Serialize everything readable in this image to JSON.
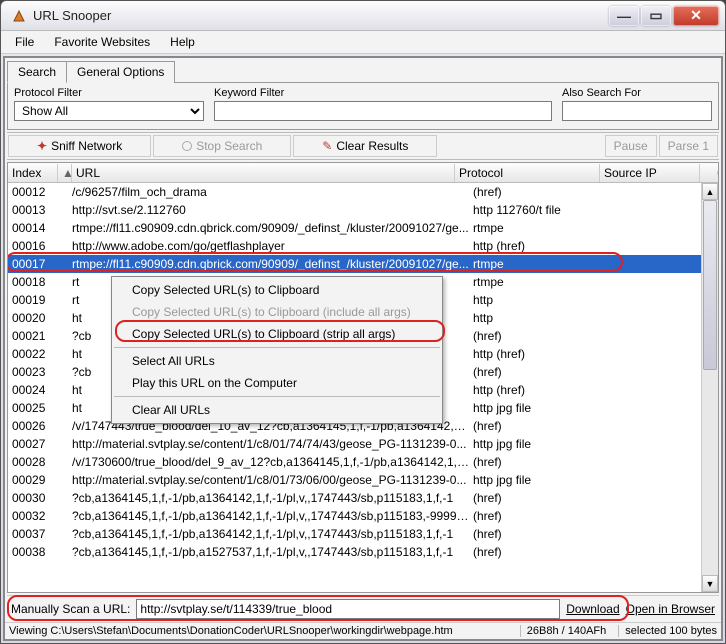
{
  "window": {
    "title": "URL Snooper"
  },
  "menubar": [
    "File",
    "Favorite Websites",
    "Help"
  ],
  "tabs": {
    "search": "Search",
    "options": "General Options"
  },
  "filters": {
    "protocol_label": "Protocol Filter",
    "protocol_value": "Show All",
    "keyword_label": "Keyword Filter",
    "keyword_value": "",
    "also_label": "Also Search For",
    "also_value": ""
  },
  "toolbar": {
    "sniff": "Sniff Network",
    "stop": "Stop Search",
    "clear": "Clear Results",
    "pause": "Pause",
    "parse": "Parse 1"
  },
  "table": {
    "headers": {
      "index": "Index",
      "url": "URL",
      "protocol": "Protocol",
      "source_ip": "Source IP"
    },
    "rows": [
      {
        "index": "00012",
        "url": "/c/96257/film_och_drama",
        "protocol": "(href)"
      },
      {
        "index": "00013",
        "url": "http://svt.se/2.112760",
        "protocol": "http 112760/t file"
      },
      {
        "index": "00014",
        "url": "rtmpe://fl11.c90909.cdn.qbrick.com/90909/_definst_/kluster/20091027/ge...",
        "protocol": "rtmpe"
      },
      {
        "index": "00016",
        "url": "http://www.adobe.com/go/getflashplayer",
        "protocol": "http (href)"
      },
      {
        "index": "00017",
        "url": "rtmpe://fl11.c90909.cdn.qbrick.com/90909/_definst_/kluster/20091027/ge...",
        "protocol": "rtmpe",
        "selected": true
      },
      {
        "index": "00018",
        "url": "rt",
        "protocol": "rtmpe"
      },
      {
        "index": "00019",
        "url": "rt",
        "protocol": "http"
      },
      {
        "index": "00020",
        "url": "ht",
        "protocol": "http"
      },
      {
        "index": "00021",
        "url": "?cb",
        "protocol": "(href)"
      },
      {
        "index": "00022",
        "url": "ht",
        "protocol": "http (href)"
      },
      {
        "index": "00023",
        "url": "?cb",
        "protocol": "(href)"
      },
      {
        "index": "00024",
        "url": "ht",
        "protocol": "http (href)"
      },
      {
        "index": "00025",
        "url": "ht",
        "protocol": "http jpg file"
      },
      {
        "index": "00026",
        "url": "/v/1747443/true_blood/del_10_av_12?cb,a1364145,1,f,-1/pb,a1364142,1,...",
        "protocol": "(href)"
      },
      {
        "index": "00027",
        "url": "http://material.svtplay.se/content/1/c8/01/74/74/43/geose_PG-1131239-0...",
        "protocol": "http jpg file"
      },
      {
        "index": "00028",
        "url": "/v/1730600/true_blood/del_9_av_12?cb,a1364145,1,f,-1/pb,a1364142,1,f...",
        "protocol": "(href)"
      },
      {
        "index": "00029",
        "url": "http://material.svtplay.se/content/1/c8/01/73/06/00/geose_PG-1131239-0...",
        "protocol": "http jpg file"
      },
      {
        "index": "00030",
        "url": "?cb,a1364145,1,f,-1/pb,a1364142,1,f,-1/pl,v,,1747443/sb,p115183,1,f,-1",
        "protocol": "(href)"
      },
      {
        "index": "00032",
        "url": "?cb,a1364145,1,f,-1/pb,a1364142,1,f,-1/pl,v,,1747443/sb,p115183,-9999,f,-1",
        "protocol": "(href)"
      },
      {
        "index": "00037",
        "url": "?cb,a1364145,1,f,-1/pb,a1364142,1,f,-1/pl,v,,1747443/sb,p115183,1,f,-1",
        "protocol": "(href)"
      },
      {
        "index": "00038",
        "url": "?cb,a1364145,1,f,-1/pb,a1527537,1,f,-1/pl,v,,1747443/sb,p115183,1,f,-1",
        "protocol": "(href)"
      }
    ]
  },
  "context_menu": {
    "copy": "Copy Selected URL(s) to Clipboard",
    "copy_include": "Copy Selected URL(s) to Clipboard (include all args)",
    "copy_strip": "Copy Selected URL(s) to Clipboard (strip all args)",
    "select_all": "Select All URLs",
    "play": "Play this URL on the Computer",
    "clear_all": "Clear All URLs"
  },
  "manual_scan": {
    "label": "Manually Scan a URL:",
    "value": "http://svtplay.se/t/114339/true_blood",
    "download": "Download",
    "open_browser": "Open in Browser"
  },
  "statusbar": {
    "path": "Viewing C:\\Users\\Stefan\\Documents\\DonationCoder\\URLSnooper\\workingdir\\webpage.htm",
    "hash": "26B8h / 140AFh",
    "selected": "selected 100 bytes"
  }
}
